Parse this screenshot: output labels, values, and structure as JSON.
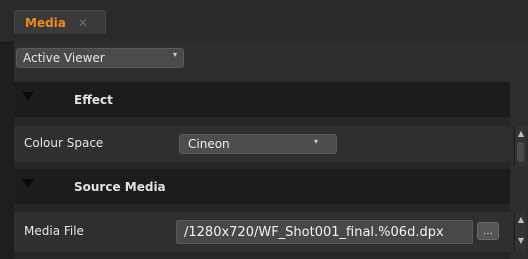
{
  "tab": {
    "label": "Media",
    "close_glyph": "✕"
  },
  "viewer_select": {
    "value": "Active Viewer",
    "arrow": "▾"
  },
  "sections": [
    {
      "title": "Effect"
    },
    {
      "title": "Source Media"
    }
  ],
  "properties": {
    "colour_space": {
      "label": "Colour Space",
      "value": "Cineon",
      "arrow": "▾"
    },
    "media_file": {
      "label": "Media File",
      "value": "/1280x720/WF_Shot001_final.%06d.dpx",
      "browse_label": "..."
    }
  },
  "scroll": {
    "up": "▲",
    "down": "▼"
  },
  "colors": {
    "accent": "#f08a1e",
    "panel": "#2d2d2d",
    "header": "#1c1c1c"
  }
}
